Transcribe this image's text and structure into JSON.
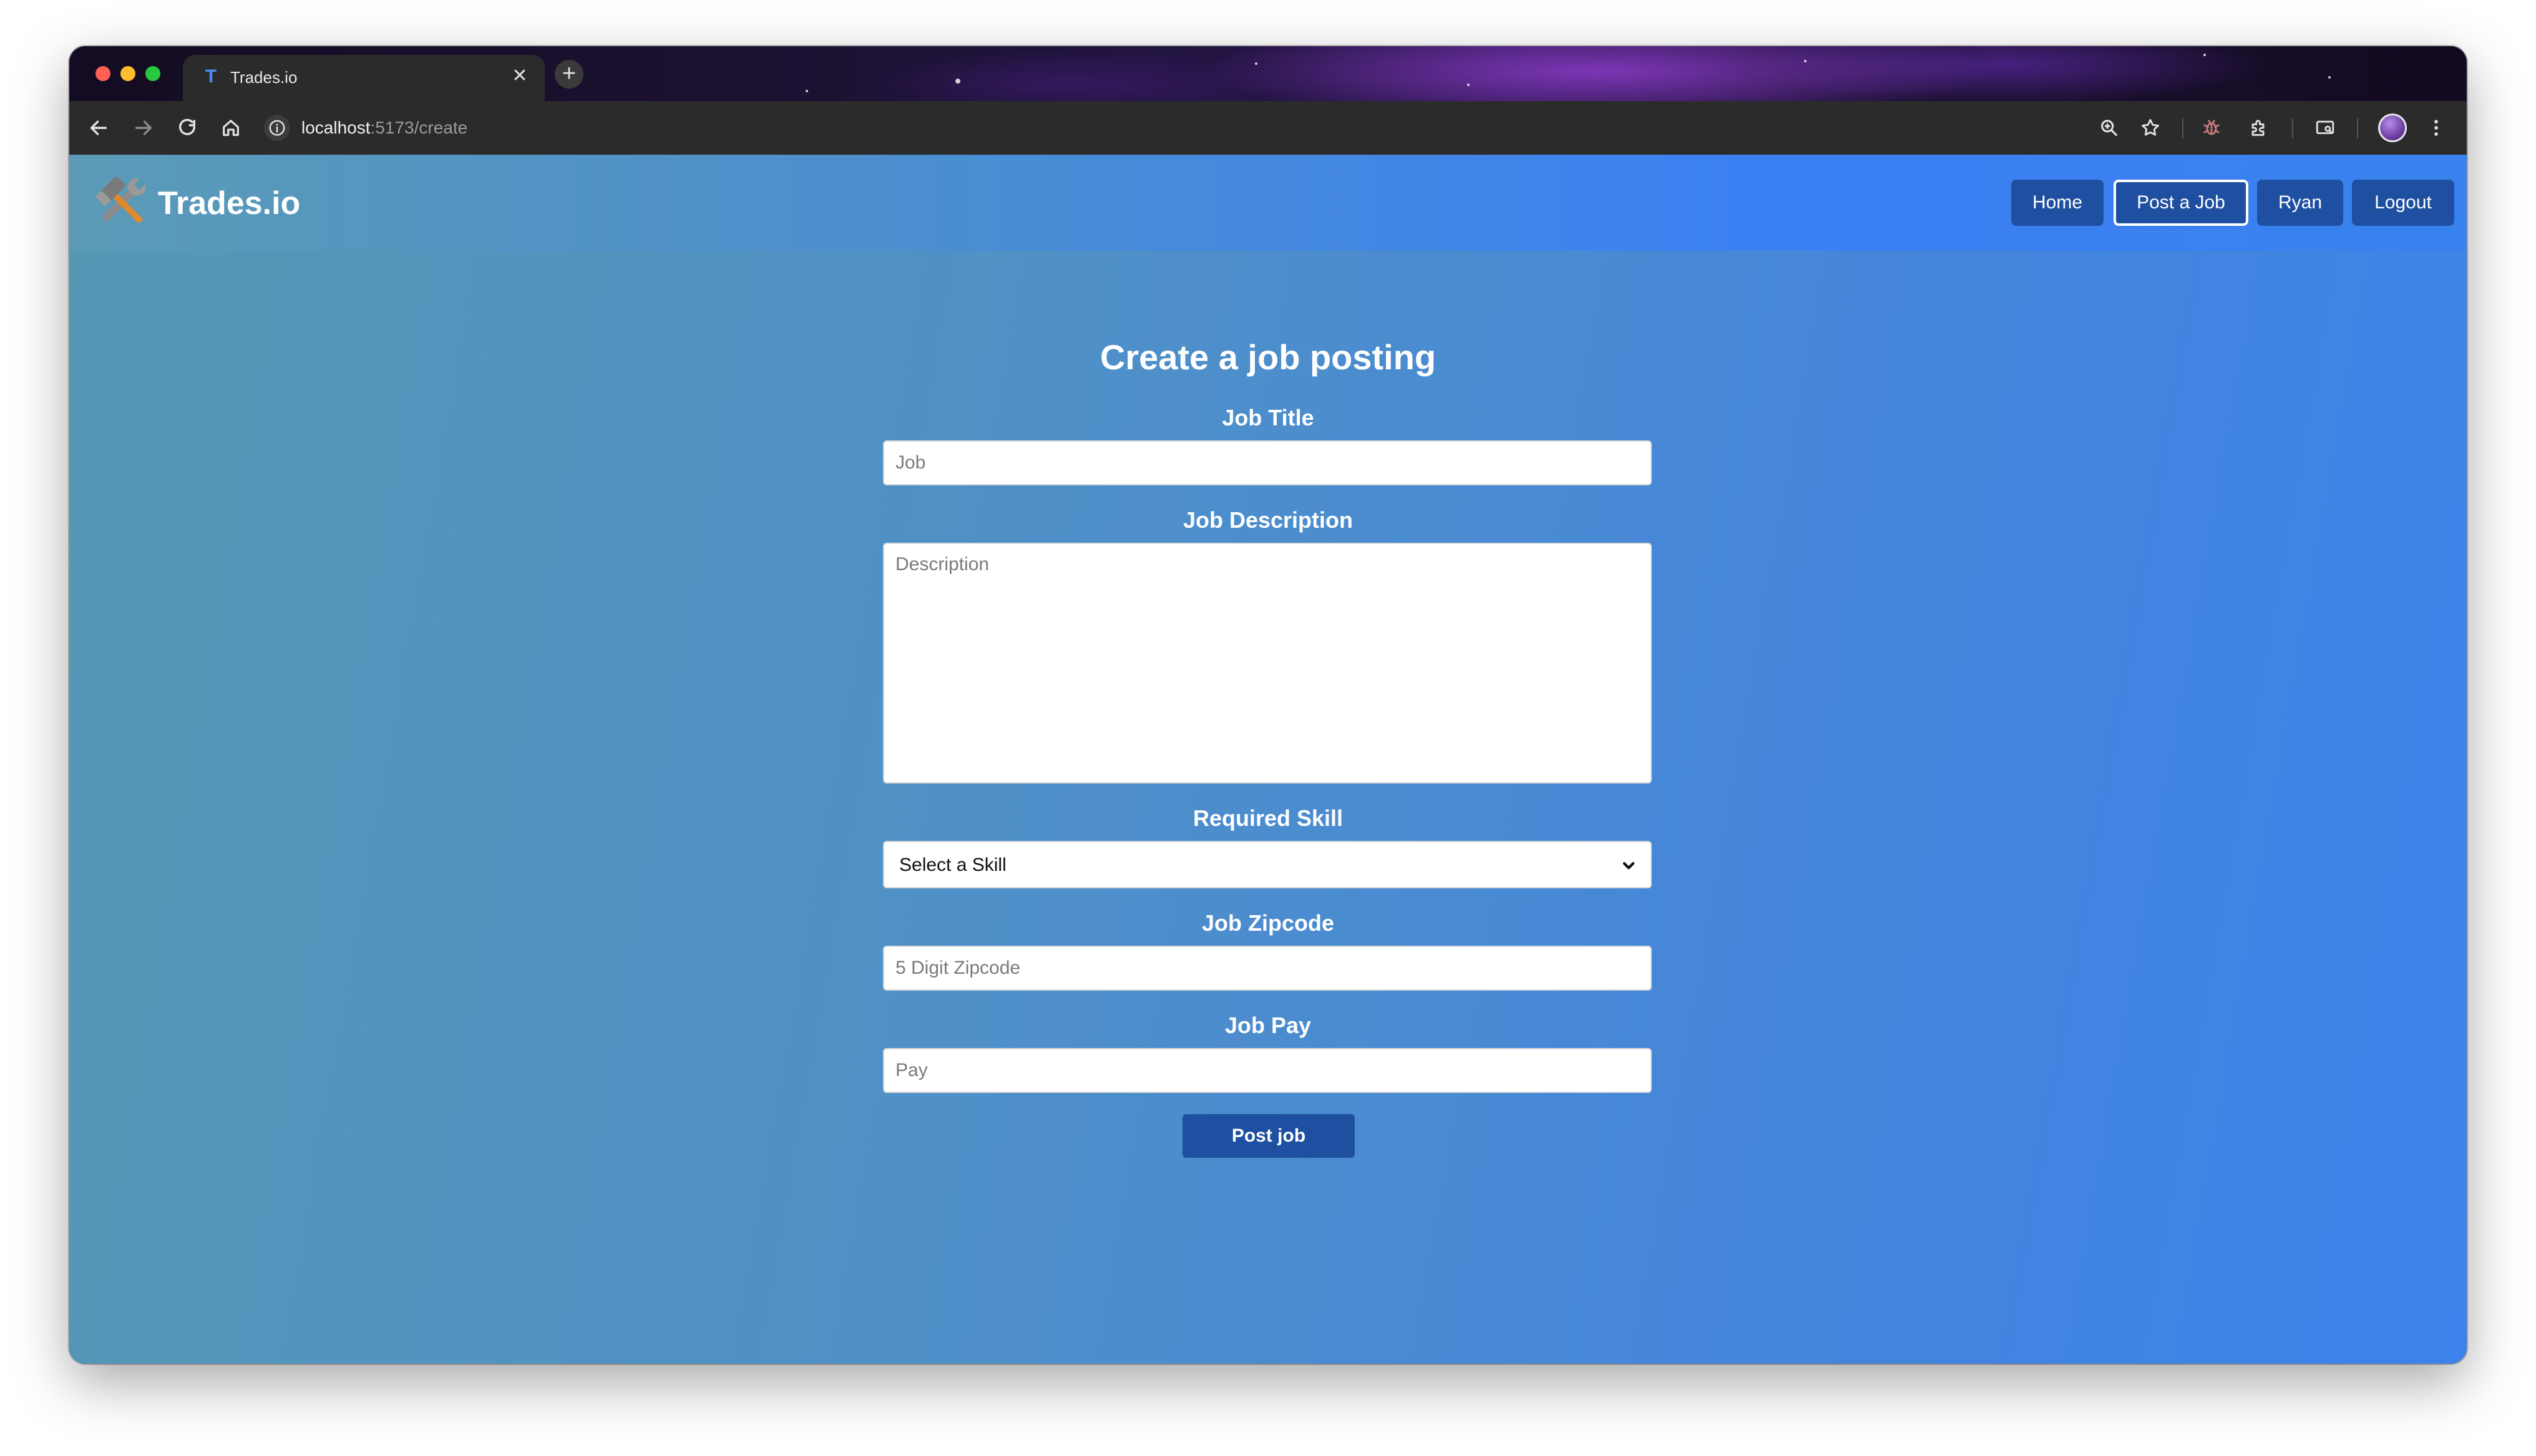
{
  "browser": {
    "tab_title": "Trades.io",
    "tab_favicon_letter": "T",
    "url_host": "localhost",
    "url_path": ":5173/create"
  },
  "navbar": {
    "brand": "Trades.io",
    "links": [
      {
        "label": "Home"
      },
      {
        "label": "Post a Job",
        "active": true
      },
      {
        "label": "Ryan"
      },
      {
        "label": "Logout"
      }
    ]
  },
  "form": {
    "title": "Create a job posting",
    "job_title": {
      "label": "Job Title",
      "placeholder": "Job",
      "value": ""
    },
    "job_description": {
      "label": "Job Description",
      "placeholder": "Description",
      "value": ""
    },
    "required_skill": {
      "label": "Required Skill",
      "selected": "Select a Skill"
    },
    "job_zipcode": {
      "label": "Job Zipcode",
      "placeholder": "5 Digit Zipcode",
      "value": ""
    },
    "job_pay": {
      "label": "Job Pay",
      "placeholder": "Pay",
      "value": ""
    },
    "submit_label": "Post job"
  },
  "colors": {
    "button_bg": "#1e4fa0",
    "gradient_start": "#5598b4",
    "gradient_end": "#3a81f0"
  }
}
